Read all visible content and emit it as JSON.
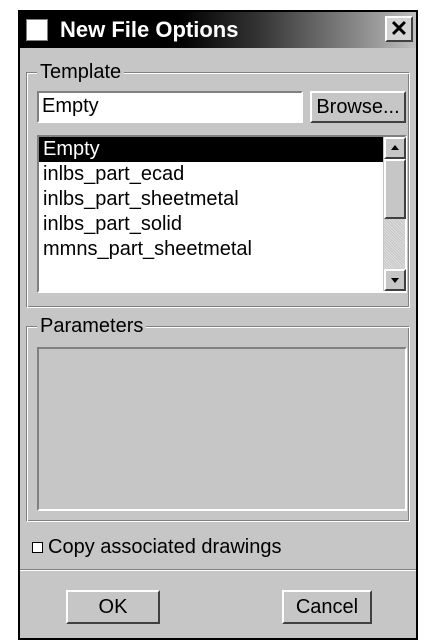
{
  "window": {
    "title": "New File Options",
    "close_glyph": "✕"
  },
  "template": {
    "legend": "Template",
    "field_value": "Empty",
    "browse_label": "Browse...",
    "items": [
      {
        "label": "Empty",
        "selected": true
      },
      {
        "label": "inlbs_part_ecad",
        "selected": false
      },
      {
        "label": "inlbs_part_sheetmetal",
        "selected": false
      },
      {
        "label": "inlbs_part_solid",
        "selected": false
      },
      {
        "label": "mmns_part_sheetmetal",
        "selected": false
      }
    ]
  },
  "parameters": {
    "legend": "Parameters"
  },
  "copy_drawings": {
    "label": "Copy associated drawings",
    "checked": false
  },
  "buttons": {
    "ok_label": "OK",
    "cancel_label": "Cancel"
  },
  "colors": {
    "dialog_bg": "#c6c6c6",
    "selection_bg": "#000000",
    "title_text": "#ffffff"
  }
}
